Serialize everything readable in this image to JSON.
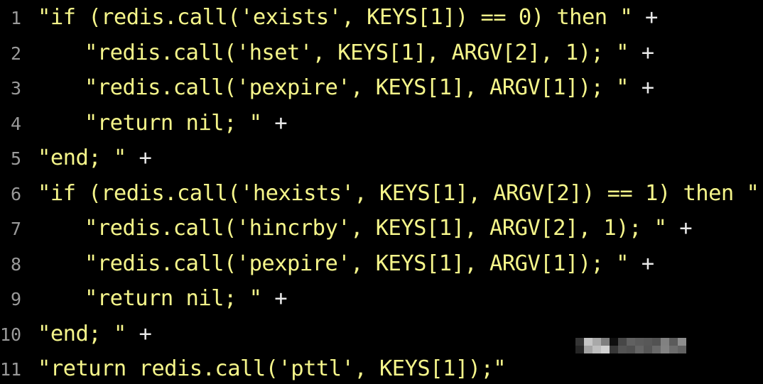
{
  "editor": {
    "background_color": "#000000",
    "gutter_color": "#9a9a9a",
    "string_color": "#f5f58a",
    "operator_color": "#e8e8e8",
    "language": "java",
    "total_lines": 11
  },
  "code": {
    "lines": [
      {
        "number": "1",
        "indent": 0,
        "text": "\"if (redis.call('exists', KEYS[1]) == 0) then \"",
        "operator": "+"
      },
      {
        "number": "2",
        "indent": 1,
        "text": "\"redis.call('hset', KEYS[1], ARGV[2], 1); \"",
        "operator": "+"
      },
      {
        "number": "3",
        "indent": 1,
        "text": "\"redis.call('pexpire', KEYS[1], ARGV[1]); \"",
        "operator": "+"
      },
      {
        "number": "4",
        "indent": 1,
        "text": "\"return nil; \"",
        "operator": "+"
      },
      {
        "number": "5",
        "indent": 0,
        "text": "\"end; \"",
        "operator": "+"
      },
      {
        "number": "6",
        "indent": 0,
        "text": "\"if (redis.call('hexists', KEYS[1], ARGV[2]) == 1) then \"",
        "operator": "+"
      },
      {
        "number": "7",
        "indent": 1,
        "text": "\"redis.call('hincrby', KEYS[1], ARGV[2], 1); \"",
        "operator": "+"
      },
      {
        "number": "8",
        "indent": 1,
        "text": "\"redis.call('pexpire', KEYS[1], ARGV[1]); \"",
        "operator": "+"
      },
      {
        "number": "9",
        "indent": 1,
        "text": "\"return nil; \"",
        "operator": "+"
      },
      {
        "number": "10",
        "indent": 0,
        "text": "\"end; \"",
        "operator": "+"
      },
      {
        "number": "11",
        "indent": 0,
        "text": "\"return redis.call('pttl', KEYS[1]);\"",
        "operator": ""
      }
    ]
  },
  "watermark": {
    "type": "mosaic-redaction",
    "visible": true
  }
}
